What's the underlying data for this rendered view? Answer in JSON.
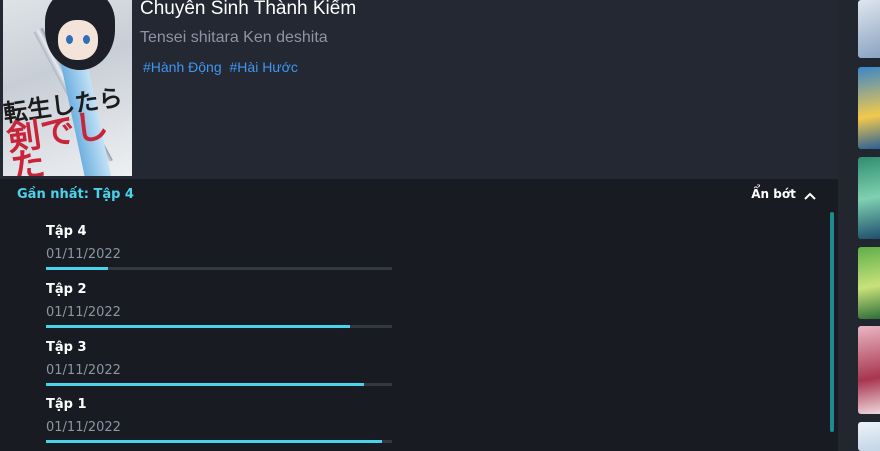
{
  "anime": {
    "title": "Chuyên Sinh Thành Kiếm",
    "alt_title": "Tensei shitara Ken deshita",
    "tags": [
      "#Hành Động",
      "#Hài Hước"
    ],
    "poster_text_line1": "転生したら",
    "poster_text_line2": "剣でした"
  },
  "episodes_header": {
    "latest_label": "Gần nhất: Tập 4",
    "collapse_label": "Ẩn bớt"
  },
  "episodes": [
    {
      "name": "Tập 4",
      "date": "01/11/2022",
      "progress": 0.18
    },
    {
      "name": "Tập 2",
      "date": "01/11/2022",
      "progress": 0.88
    },
    {
      "name": "Tập 3",
      "date": "01/11/2022",
      "progress": 0.92
    },
    {
      "name": "Tập 1",
      "date": "01/11/2022",
      "progress": 0.97
    }
  ],
  "colors": {
    "accent": "#4ad3ec",
    "tag": "#3e96f2"
  }
}
